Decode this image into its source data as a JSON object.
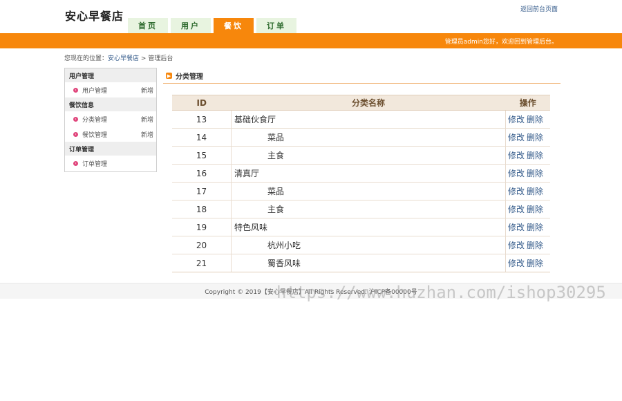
{
  "header": {
    "site_title": "安心早餐店",
    "back_link": "返回前台页面",
    "nav": [
      {
        "label": "首页",
        "active": false
      },
      {
        "label": "用户",
        "active": false
      },
      {
        "label": "餐饮",
        "active": true
      },
      {
        "label": "订单",
        "active": false
      }
    ],
    "welcome": "管理员admin您好，欢迎回到管理后台。"
  },
  "breadcrumb": {
    "prefix": "您现在的位置：",
    "home": "安心早餐店",
    "sep": ">",
    "current": "管理后台"
  },
  "sidebar": {
    "groups": [
      {
        "title": "用户管理",
        "items": [
          {
            "label": "用户管理",
            "action": "新增"
          }
        ]
      },
      {
        "title": "餐饮信息",
        "items": [
          {
            "label": "分类管理",
            "action": "新增"
          },
          {
            "label": "餐饮管理",
            "action": "新增"
          }
        ]
      },
      {
        "title": "订单管理",
        "items": [
          {
            "label": "订单管理",
            "action": ""
          }
        ]
      }
    ]
  },
  "main": {
    "section_title": "分类管理",
    "table": {
      "headers": [
        "ID",
        "分类名称",
        "操作"
      ],
      "rows": [
        {
          "id": "13",
          "name": "基础伙食厅",
          "child": false
        },
        {
          "id": "14",
          "name": "菜品",
          "child": true
        },
        {
          "id": "15",
          "name": "主食",
          "child": true
        },
        {
          "id": "16",
          "name": "清真厅",
          "child": false
        },
        {
          "id": "17",
          "name": "菜品",
          "child": true
        },
        {
          "id": "18",
          "name": "主食",
          "child": true
        },
        {
          "id": "19",
          "name": "特色风味",
          "child": false
        },
        {
          "id": "20",
          "name": "杭州小吃",
          "child": true
        },
        {
          "id": "21",
          "name": "蜀香风味",
          "child": true
        }
      ],
      "edit_label": "修改",
      "delete_label": "删除"
    }
  },
  "footer": {
    "text": "Copyright © 2019【安心早餐店】All Rights Reserved. 沪ICP备00000号"
  },
  "watermark": "https://www.huzhan.com/ishop30295"
}
